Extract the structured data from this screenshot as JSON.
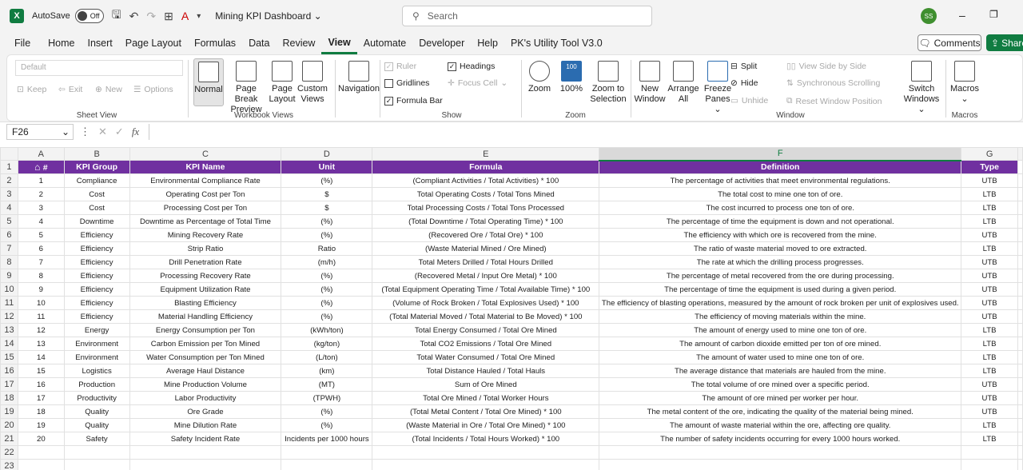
{
  "titlebar": {
    "autosave_label": "AutoSave",
    "autosave_state": "Off",
    "doc_title": "Mining KPI Dashboard",
    "search_placeholder": "Search",
    "avatar_initials": "SS"
  },
  "menu": [
    "File",
    "Home",
    "Insert",
    "Page Layout",
    "Formulas",
    "Data",
    "Review",
    "View",
    "Automate",
    "Developer",
    "Help",
    "PK's Utility Tool V3.0"
  ],
  "menu_active": "View",
  "comments_label": "Comments",
  "share_label": "Share",
  "ribbon": {
    "sheet_view": {
      "dropdown": "Default",
      "keep": "Keep",
      "exit": "Exit",
      "new": "New",
      "options": "Options",
      "label": "Sheet View"
    },
    "workbook_views": {
      "normal": "Normal",
      "page_break_1": "Page Break",
      "page_break_2": "Preview",
      "page_layout_1": "Page",
      "page_layout_2": "Layout",
      "custom_1": "Custom",
      "custom_2": "Views",
      "label": "Workbook Views"
    },
    "navigation": "Navigation",
    "show": {
      "ruler": "Ruler",
      "gridlines": "Gridlines",
      "formula_bar": "Formula Bar",
      "headings": "Headings",
      "focus_cell": "Focus Cell",
      "label": "Show"
    },
    "zoom": {
      "zoom": "Zoom",
      "hundred": "100%",
      "zoom_sel_1": "Zoom to",
      "zoom_sel_2": "Selection",
      "label": "Zoom",
      "icon_text": "100"
    },
    "window": {
      "new_1": "New",
      "new_2": "Window",
      "arrange_1": "Arrange",
      "arrange_2": "All",
      "freeze_1": "Freeze",
      "freeze_2": "Panes",
      "split": "Split",
      "hide": "Hide",
      "unhide": "Unhide",
      "side_by_side": "View Side by Side",
      "sync_scroll": "Synchronous Scrolling",
      "reset_pos": "Reset Window Position",
      "switch_1": "Switch",
      "switch_2": "Windows",
      "label": "Window"
    },
    "macros": {
      "macros": "Macros",
      "label": "Macros"
    }
  },
  "formula_bar": {
    "cell_ref": "F26",
    "fx": "fx"
  },
  "columns": [
    "A",
    "B",
    "C",
    "D",
    "E",
    "F",
    "G"
  ],
  "selected_column": "F",
  "header_row": [
    "#",
    "KPI Group",
    "KPI Name",
    "Unit",
    "Formula",
    "Definition",
    "Type"
  ],
  "rows": [
    [
      "1",
      "Compliance",
      "Environmental Compliance Rate",
      "(%)",
      "(Compliant Activities / Total Activities) * 100",
      "The percentage of activities that meet environmental regulations.",
      "UTB"
    ],
    [
      "2",
      "Cost",
      "Operating Cost per Ton",
      "$",
      "Total Operating Costs / Total Tons Mined",
      "The total cost to mine one ton of ore.",
      "LTB"
    ],
    [
      "3",
      "Cost",
      "Processing Cost per Ton",
      "$",
      "Total Processing Costs / Total Tons Processed",
      "The cost incurred to process one ton of ore.",
      "LTB"
    ],
    [
      "4",
      "Downtime",
      "Downtime as Percentage of Total Time",
      "(%)",
      "(Total Downtime / Total Operating Time) * 100",
      "The percentage of time the equipment is down and not operational.",
      "LTB"
    ],
    [
      "5",
      "Efficiency",
      "Mining Recovery Rate",
      "(%)",
      "(Recovered Ore / Total Ore) * 100",
      "The efficiency with which ore is recovered from the mine.",
      "UTB"
    ],
    [
      "6",
      "Efficiency",
      "Strip Ratio",
      "Ratio",
      "(Waste Material Mined / Ore Mined)",
      "The ratio of waste material moved to ore extracted.",
      "LTB"
    ],
    [
      "7",
      "Efficiency",
      "Drill Penetration Rate",
      "(m/h)",
      "Total Meters Drilled / Total Hours Drilled",
      "The rate at which the drilling process progresses.",
      "UTB"
    ],
    [
      "8",
      "Efficiency",
      "Processing Recovery Rate",
      "(%)",
      "(Recovered Metal / Input Ore Metal) * 100",
      "The percentage of metal recovered from the ore during processing.",
      "UTB"
    ],
    [
      "9",
      "Efficiency",
      "Equipment Utilization Rate",
      "(%)",
      "(Total Equipment Operating Time / Total Available Time) * 100",
      "The percentage of time the equipment is used during a given period.",
      "UTB"
    ],
    [
      "10",
      "Efficiency",
      "Blasting Efficiency",
      "(%)",
      "(Volume of Rock Broken / Total Explosives Used) * 100",
      "The efficiency of blasting operations, measured by the amount of rock broken per unit of explosives used.",
      "UTB"
    ],
    [
      "11",
      "Efficiency",
      "Material Handling Efficiency",
      "(%)",
      "(Total Material Moved / Total Material to Be Moved) * 100",
      "The efficiency of moving materials within the mine.",
      "UTB"
    ],
    [
      "12",
      "Energy",
      "Energy Consumption per Ton",
      "(kWh/ton)",
      "Total Energy Consumed / Total Ore Mined",
      "The amount of energy used to mine one ton of ore.",
      "LTB"
    ],
    [
      "13",
      "Environment",
      "Carbon Emission per Ton Mined",
      "(kg/ton)",
      "Total CO2 Emissions / Total Ore Mined",
      "The amount of carbon dioxide emitted per ton of ore mined.",
      "LTB"
    ],
    [
      "14",
      "Environment",
      "Water Consumption per Ton Mined",
      "(L/ton)",
      "Total Water Consumed / Total Ore Mined",
      "The amount of water used to mine one ton of ore.",
      "LTB"
    ],
    [
      "15",
      "Logistics",
      "Average Haul Distance",
      "(km)",
      "Total Distance Hauled / Total Hauls",
      "The average distance that materials are hauled from the mine.",
      "LTB"
    ],
    [
      "16",
      "Production",
      "Mine Production Volume",
      "(MT)",
      "Sum of Ore Mined",
      "The total volume of ore mined over a specific period.",
      "UTB"
    ],
    [
      "17",
      "Productivity",
      "Labor Productivity",
      "(TPWH)",
      "Total Ore Mined / Total Worker Hours",
      "The amount of ore mined per worker per hour.",
      "UTB"
    ],
    [
      "18",
      "Quality",
      "Ore Grade",
      "(%)",
      "(Total Metal Content / Total Ore Mined) * 100",
      "The metal content of the ore, indicating the quality of the material being mined.",
      "UTB"
    ],
    [
      "19",
      "Quality",
      "Mine Dilution Rate",
      "(%)",
      "(Waste Material in Ore / Total Ore Mined) * 100",
      "The amount of waste material within the ore, affecting ore quality.",
      "LTB"
    ],
    [
      "20",
      "Safety",
      "Safety Incident Rate",
      "Incidents per 1000 hours",
      "(Total Incidents / Total Hours Worked) * 100",
      "The number of safety incidents occurring for every 1000 hours worked.",
      "LTB"
    ]
  ],
  "extra_row_numbers": [
    "22",
    "23"
  ]
}
